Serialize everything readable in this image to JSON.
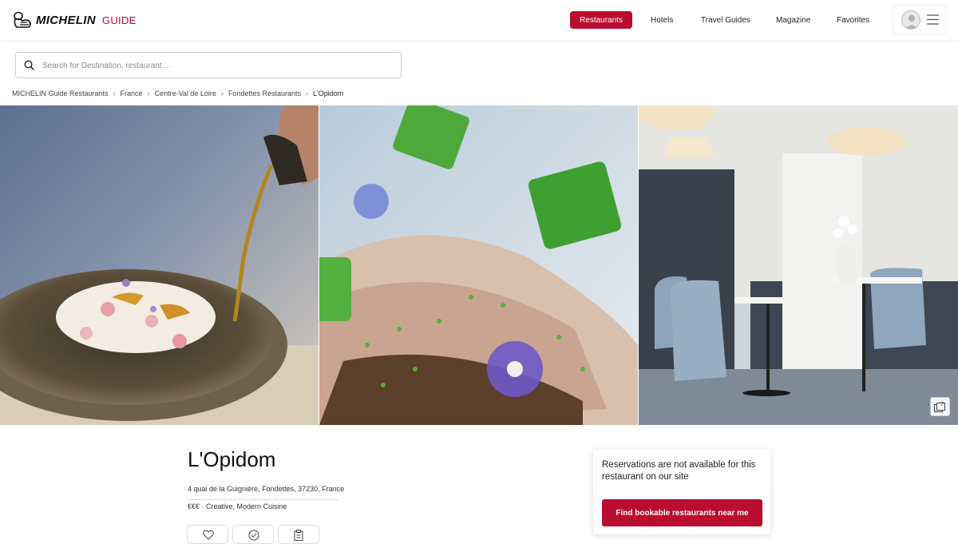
{
  "header": {
    "logo_wordmark": "MICHELIN",
    "logo_suffix": "GUIDE",
    "nav": {
      "restaurants": "Restaurants",
      "hotels": "Hotels",
      "travel_guides": "Travel Guides",
      "magazine": "Magazine",
      "favorites": "Favorites"
    },
    "active_nav": "Restaurants"
  },
  "search": {
    "placeholder": "Search for Destination, restaurant ...",
    "value": ""
  },
  "breadcrumb": [
    "MICHELIN Guide Restaurants",
    "France",
    "Centre-Val de Loire",
    "Fondettes Restaurants",
    "L'Opidom"
  ],
  "gallery": {
    "photo_count": "7",
    "photos": [
      "plated-dish-sauce-pour",
      "foie-gras-closeup",
      "dining-room-interior"
    ]
  },
  "restaurant": {
    "name": "L'Opidom",
    "address": "4 quai de la Guignière, Fondettes, 37230, France",
    "price_cuisine": "€€€ · Creative, Modern Cuisine"
  },
  "actions": [
    "heart-icon",
    "check-circle-icon",
    "clipboard-icon"
  ],
  "reservation": {
    "message": "Reservations are not available for this restaurant on our site",
    "button_label": "Find bookable restaurants near me"
  },
  "colors": {
    "brand_red": "#ba0c2f"
  }
}
